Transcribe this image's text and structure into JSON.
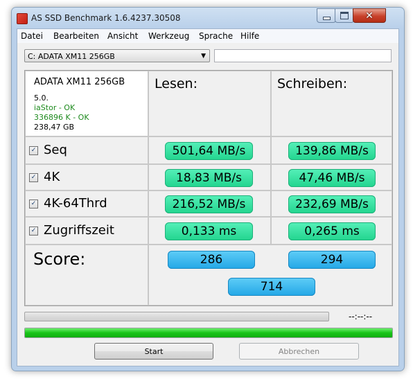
{
  "window": {
    "title": "AS SSD Benchmark 1.6.4237.30508"
  },
  "menu": [
    "Datei",
    "Bearbeiten",
    "Ansicht",
    "Werkzeug",
    "Sprache",
    "Hilfe"
  ],
  "drive_select": {
    "value": "C: ADATA XM11 256GB",
    "extra_field": ""
  },
  "info": {
    "name": "ADATA XM11 256GB",
    "firmware": "5.0.",
    "driver_status": "iaStor - OK",
    "alignment_status": "336896 K - OK",
    "capacity": "238,47 GB",
    "ok_color": "#1d8a1d"
  },
  "columns": {
    "read": "Lesen:",
    "write": "Schreiben:"
  },
  "rows": [
    {
      "label": "Seq",
      "checked": true,
      "read": "501,64 MB/s",
      "write": "139,86 MB/s"
    },
    {
      "label": "4K",
      "checked": true,
      "read": "18,83 MB/s",
      "write": "47,46 MB/s"
    },
    {
      "label": "4K-64Thrd",
      "checked": true,
      "read": "216,52 MB/s",
      "write": "232,69 MB/s"
    },
    {
      "label": "Zugriffszeit",
      "checked": true,
      "read": "0,133 ms",
      "write": "0,265 ms"
    }
  ],
  "score": {
    "label": "Score:",
    "read": "286",
    "write": "294",
    "total": "714"
  },
  "progress": {
    "current_fraction": 0,
    "total_fraction": 1.0,
    "time_text": "--:--:--"
  },
  "buttons": {
    "start": "Start",
    "cancel": "Abbrechen"
  },
  "colors": {
    "value_green": "#22d48e",
    "score_blue": "#23a7e6",
    "progress_green": "#18c418"
  }
}
